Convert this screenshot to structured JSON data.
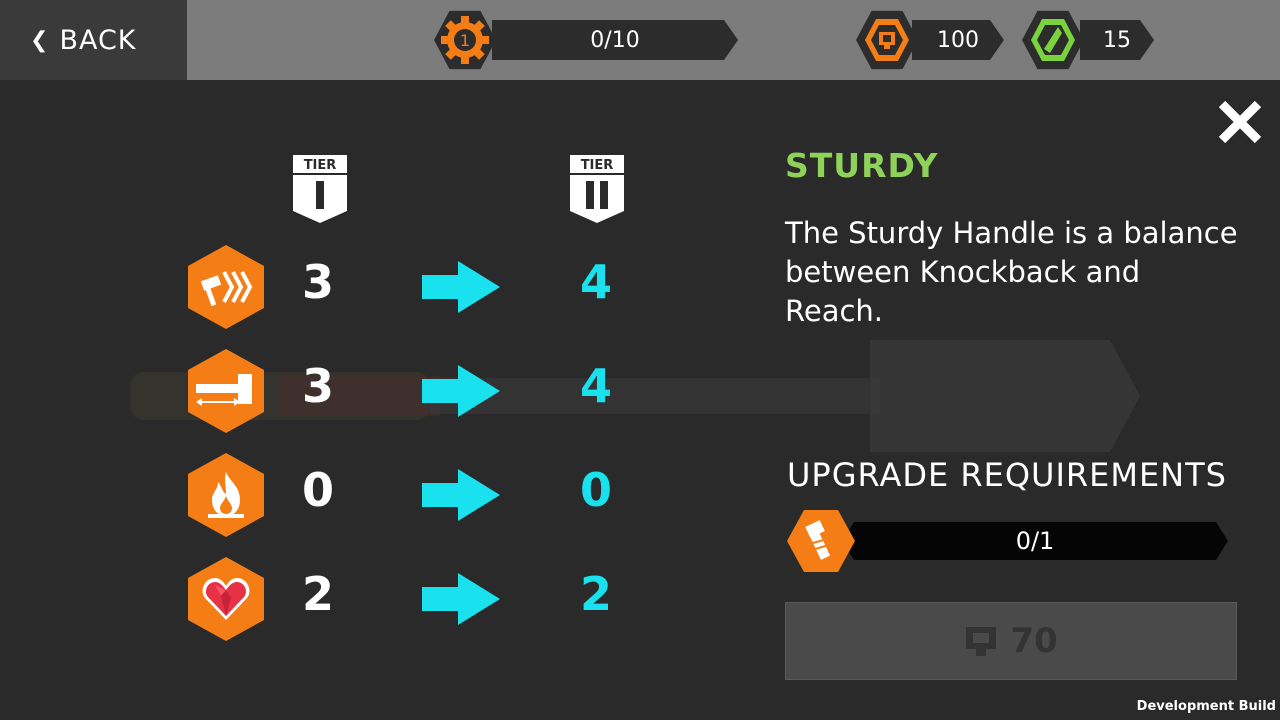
{
  "topbar": {
    "back_label": "BACK",
    "level": "1",
    "level_progress": "0/10",
    "coins": "100",
    "gems": "15"
  },
  "tiers": [
    "I",
    "II"
  ],
  "tier_label": "TIER",
  "stats": [
    {
      "icon": "knockback-icon",
      "current": "3",
      "next": "4"
    },
    {
      "icon": "reach-icon",
      "current": "3",
      "next": "4"
    },
    {
      "icon": "fire-icon",
      "current": "0",
      "next": "0"
    },
    {
      "icon": "heart-icon",
      "current": "2",
      "next": "2"
    }
  ],
  "item": {
    "name": "STURDY",
    "description": "The Sturdy Handle is a balance between Knockback and Reach."
  },
  "requirements": {
    "title": "UPGRADE REQUIREMENTS",
    "progress": "0/1",
    "icon": "handle-part-icon"
  },
  "upgrade": {
    "cost": "70"
  },
  "footer": {
    "build_label": "Development Build"
  },
  "colors": {
    "accent_orange": "#f57d15",
    "cyan": "#19e1ee",
    "title_green": "#8fd25a",
    "gem_green": "#7ad23c"
  }
}
